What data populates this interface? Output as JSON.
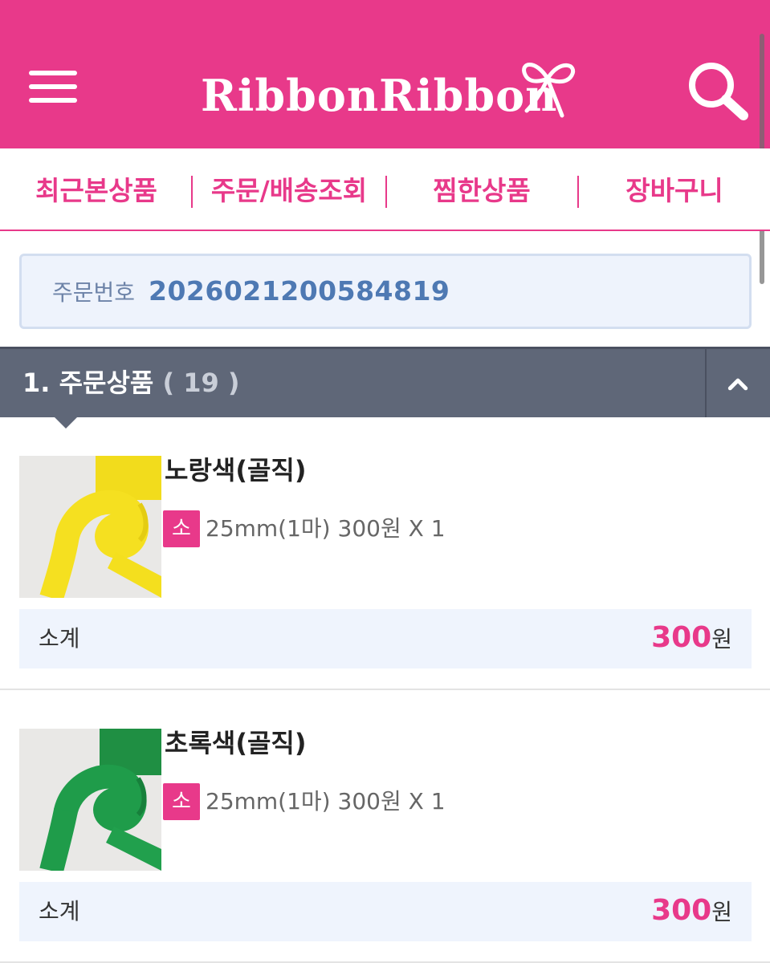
{
  "header": {
    "logo_text": "RibbonRibbon",
    "menu_icon": "hamburger-menu-icon",
    "search_icon": "search-icon",
    "brand_color": "#e8398a"
  },
  "tabs": [
    {
      "label": "최근본상품"
    },
    {
      "label": "주문/배송조회"
    },
    {
      "label": "찜한상품"
    },
    {
      "label": "장바구니"
    }
  ],
  "order": {
    "label": "주문번호",
    "number": "2026021200584819"
  },
  "section": {
    "title": "1. 주문상품",
    "count": "( 19 )",
    "toggle_icon": "chevron-up-icon"
  },
  "items": [
    {
      "name": "노랑색(골직)",
      "size_badge": "소",
      "option": "25mm(1마) 300원 X 1",
      "subtotal_label": "소계",
      "subtotal_amount": "300",
      "subtotal_unit": "원",
      "ribbon_color": "#f5e020"
    },
    {
      "name": "초록색(골직)",
      "size_badge": "소",
      "option": "25mm(1마) 300원 X 1",
      "subtotal_label": "소계",
      "subtotal_amount": "300",
      "subtotal_unit": "원",
      "ribbon_color": "#1f9c4a"
    }
  ]
}
